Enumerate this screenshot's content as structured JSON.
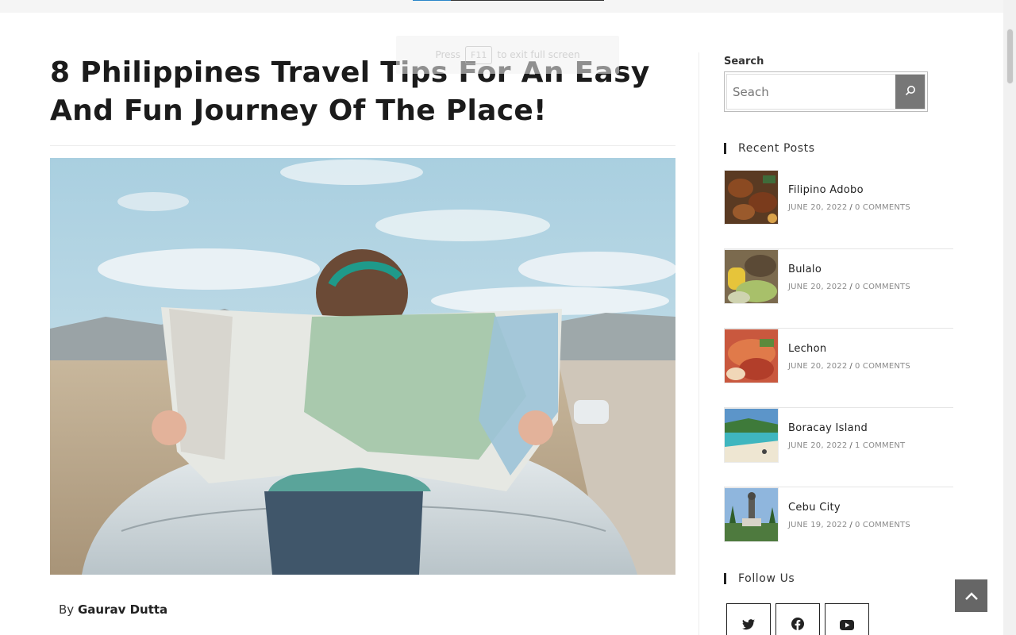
{
  "fullscreen_notice": {
    "press": "Press",
    "key": "F11",
    "rest": "to exit full screen"
  },
  "article": {
    "title": "8 Philippines Travel Tips For An Easy And Fun Journey Of The Place!",
    "hero_image": "woman-reading-map-on-car-hood",
    "byline_prefix": "By",
    "author": "Gaurav Dutta"
  },
  "sidebar": {
    "search": {
      "label": "Search",
      "placeholder": "Seach",
      "button_icon": "search-icon"
    },
    "recent_posts": {
      "heading": "Recent Posts",
      "items": [
        {
          "title": "Filipino Adobo",
          "date": "JUNE 20, 2022",
          "comments": "0 COMMENTS",
          "thumb": "adobo-thumbnail"
        },
        {
          "title": "Bulalo",
          "date": "JUNE 20, 2022",
          "comments": "0 COMMENTS",
          "thumb": "bulalo-thumbnail"
        },
        {
          "title": "Lechon",
          "date": "JUNE 20, 2022",
          "comments": "0 COMMENTS",
          "thumb": "lechon-thumbnail"
        },
        {
          "title": "Boracay Island",
          "date": "JUNE 20, 2022",
          "comments": "1 COMMENT",
          "thumb": "boracay-thumbnail"
        },
        {
          "title": "Cebu City",
          "date": "JUNE 19, 2022",
          "comments": "0 COMMENTS",
          "thumb": "cebu-thumbnail"
        }
      ]
    },
    "follow": {
      "heading": "Follow Us",
      "icons": [
        "twitter-icon",
        "facebook-icon",
        "youtube-icon"
      ]
    }
  },
  "back_to_top_icon": "chevron-up-icon",
  "colors": {
    "text": "#1b1b1b",
    "button": "#777777",
    "back_to_top": "#666666",
    "meta": "#8a8a8a"
  }
}
